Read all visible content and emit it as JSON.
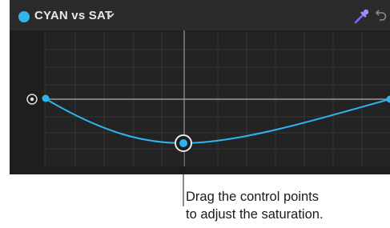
{
  "header": {
    "title": "CYAN vs SAT",
    "dot_color": "#2fb4ee",
    "dropdown_icon": "chevron-down-icon",
    "eyedropper_icon": "eyedropper-icon",
    "undo_icon": "undo-icon"
  },
  "curve": {
    "color": "#2fb4ee",
    "control_points": [
      "left-end-point",
      "center-point",
      "right-end-point"
    ],
    "selected_point": "center-point",
    "reset_icon": "target-reset-icon"
  },
  "callout": {
    "line1": "Drag the control points",
    "line2": "to adjust the saturation."
  }
}
